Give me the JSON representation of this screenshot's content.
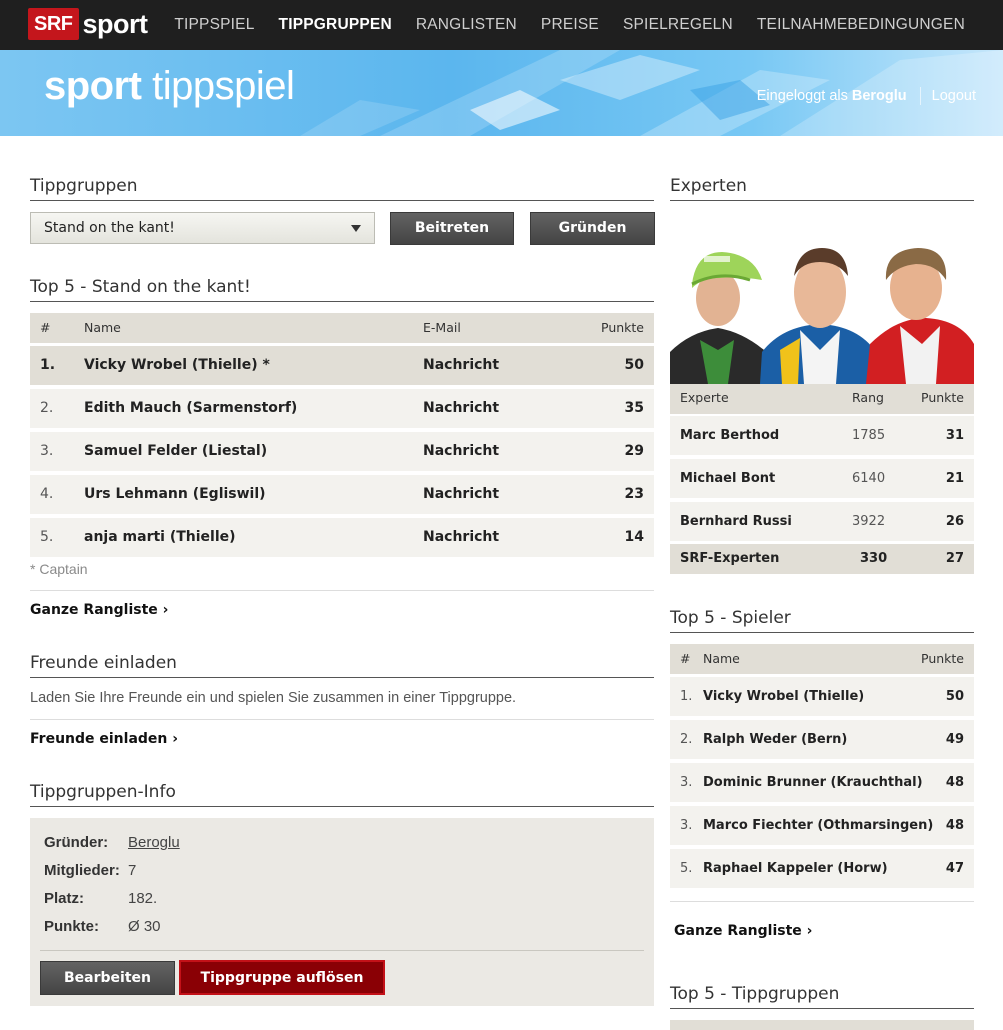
{
  "brand": {
    "srf": "SRF",
    "sport": "sport"
  },
  "nav": [
    "TIPPSPIEL",
    "TIPPGRUPPEN",
    "RANGLISTEN",
    "PREISE",
    "SPIELREGELN",
    "TEILNAHMEBEDINGUNGEN"
  ],
  "nav_active_index": 1,
  "banner": {
    "title_bold": "sport",
    "title_light": "tippspiel",
    "logged_in_prefix": "Eingeloggt als",
    "user": "Beroglu",
    "logout": "Logout"
  },
  "tippgruppen": {
    "heading": "Tippgruppen",
    "selected_group": "Stand on the kant!",
    "join_label": "Beitreten",
    "create_label": "Gründen"
  },
  "top5_group": {
    "heading": "Top 5 - Stand on the kant!",
    "columns": {
      "rank": "#",
      "name": "Name",
      "email": "E-Mail",
      "points": "Punkte"
    },
    "rows": [
      {
        "rank": "1.",
        "name": "Vicky Wrobel (Thielle) *",
        "email": "Nachricht",
        "points": "50"
      },
      {
        "rank": "2.",
        "name": "Edith Mauch (Sarmenstorf)",
        "email": "Nachricht",
        "points": "35"
      },
      {
        "rank": "3.",
        "name": "Samuel Felder (Liestal)",
        "email": "Nachricht",
        "points": "29"
      },
      {
        "rank": "4.",
        "name": "Urs Lehmann (Egliswil)",
        "email": "Nachricht",
        "points": "23"
      },
      {
        "rank": "5.",
        "name": "anja marti (Thielle)",
        "email": "Nachricht",
        "points": "14"
      }
    ],
    "captain_note": "* Captain",
    "full_ranking_link": "Ganze Rangliste ›"
  },
  "invite": {
    "heading": "Freunde einladen",
    "text": "Laden Sie Ihre Freunde ein und spielen Sie zusammen in einer Tippgruppe.",
    "link": "Freunde einladen ›"
  },
  "group_info": {
    "heading": "Tippgruppen-Info",
    "founder_label": "Gründer:",
    "founder_value": "Beroglu",
    "members_label": "Mitglieder:",
    "members_value": "7",
    "place_label": "Platz:",
    "place_value": "182.",
    "points_label": "Punkte:",
    "points_value": "Ø 30",
    "edit_label": "Bearbeiten",
    "dissolve_label": "Tippgruppe auflösen"
  },
  "experts": {
    "heading": "Experten",
    "columns": {
      "expert": "Experte",
      "rank": "Rang",
      "points": "Punkte"
    },
    "rows": [
      {
        "name": "Marc Berthod",
        "rank": "1785",
        "points": "31"
      },
      {
        "name": "Michael Bont",
        "rank": "6140",
        "points": "21"
      },
      {
        "name": "Bernhard Russi",
        "rank": "3922",
        "points": "26"
      }
    ],
    "summary": {
      "name": "SRF-Experten",
      "rank": "330",
      "points": "27"
    }
  },
  "top5_players": {
    "heading": "Top 5 - Spieler",
    "columns": {
      "rank": "#",
      "name": "Name",
      "points": "Punkte"
    },
    "rows": [
      {
        "rank": "1.",
        "name": "Vicky Wrobel (Thielle)",
        "points": "50"
      },
      {
        "rank": "2.",
        "name": "Ralph Weder (Bern)",
        "points": "49"
      },
      {
        "rank": "3.",
        "name": "Dominic Brunner (Krauchthal)",
        "points": "48"
      },
      {
        "rank": "3.",
        "name": "Marco Fiechter (Othmarsingen)",
        "points": "48"
      },
      {
        "rank": "5.",
        "name": "Raphael Kappeler (Horw)",
        "points": "47"
      }
    ],
    "full_ranking_link": "Ganze Rangliste ›"
  },
  "top5_groups": {
    "heading": "Top 5 - Tippgruppen"
  },
  "colors": {
    "brand_red": "#c4161c",
    "dark_button": "#4f4f4f",
    "danger_button": "#8a0005",
    "table_header": "#e1ded6",
    "row_bg": "#f3f2ee",
    "banner_blue": "#5bb6ee"
  }
}
